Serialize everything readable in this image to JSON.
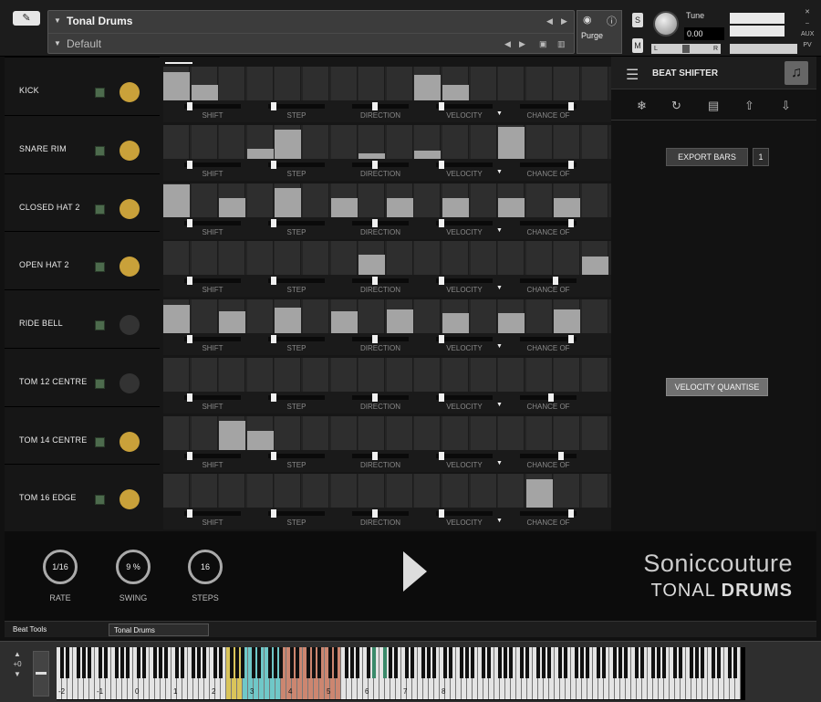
{
  "header": {
    "instrument_name": "Tonal Drums",
    "preset_name": "Default",
    "purge_label": "Purge",
    "tune_label": "Tune",
    "tune_value": "0.00",
    "solo_label": "S",
    "mute_label": "M",
    "pan_left": "L",
    "pan_right": "R",
    "aux_label": "AUX",
    "pv_label": "PV"
  },
  "controls_labels": {
    "shift": "SHIFT",
    "step": "STEP",
    "direction": "DIRECTION",
    "velocity": "VELOCITY",
    "chance": "CHANCE OF"
  },
  "tracks": [
    {
      "name": "KICK",
      "active": true,
      "bars": [
        0.85,
        0.45,
        0,
        0,
        0,
        0,
        0,
        0,
        0,
        0.75,
        0.45,
        0,
        0,
        0,
        0,
        0
      ]
    },
    {
      "name": "SNARE RIM",
      "active": true,
      "bars": [
        0,
        0,
        0,
        0.3,
        0.85,
        0,
        0,
        0.15,
        0,
        0.25,
        0,
        0,
        0.95,
        0,
        0,
        0
      ]
    },
    {
      "name": "CLOSED HAT 2",
      "active": true,
      "bars": [
        0.95,
        0,
        0.55,
        0,
        0.85,
        0,
        0.55,
        0,
        0.55,
        0,
        0.55,
        0,
        0.55,
        0,
        0.55,
        0
      ]
    },
    {
      "name": "OPEN HAT 2",
      "active": true,
      "bars": [
        0,
        0,
        0,
        0,
        0,
        0,
        0,
        0.6,
        0,
        0,
        0,
        0,
        0,
        0,
        0,
        0.55
      ]
    },
    {
      "name": "RIDE BELL",
      "active": false,
      "bars": [
        0.85,
        0,
        0.65,
        0,
        0.75,
        0,
        0.65,
        0,
        0.7,
        0,
        0.6,
        0,
        0.6,
        0,
        0.7,
        0
      ]
    },
    {
      "name": "TOM 12 CENTRE",
      "active": false,
      "bars": [
        0,
        0,
        0,
        0,
        0,
        0,
        0,
        0,
        0,
        0,
        0,
        0,
        0,
        0,
        0,
        0
      ]
    },
    {
      "name": "TOM 14 CENTRE",
      "active": true,
      "bars": [
        0,
        0,
        0.85,
        0.55,
        0,
        0,
        0,
        0,
        0,
        0,
        0,
        0,
        0,
        0,
        0,
        0
      ]
    },
    {
      "name": "TOM 16 EDGE",
      "active": true,
      "bars": [
        0,
        0,
        0,
        0,
        0,
        0,
        0,
        0,
        0,
        0,
        0,
        0,
        0,
        0.85,
        0,
        0
      ]
    }
  ],
  "colors": {
    "active_dot": "#c9a13a",
    "inactive_dot": "#333333",
    "mute_green": "#4d6b4d",
    "bar": "#a4a4a4"
  },
  "beat_shifter": {
    "title": "BEAT SHIFTER",
    "export_label": "EXPORT BARS",
    "export_value": "1",
    "velocity_quantise_label": "VELOCITY QUANTISE",
    "icons": [
      "snowflake-icon",
      "loop-icon",
      "chip-icon",
      "upload-icon",
      "download-icon"
    ]
  },
  "footer": {
    "rate_value": "1/16",
    "rate_label": "RATE",
    "swing_value": "9 %",
    "swing_label": "SWING",
    "steps_value": "16",
    "steps_label": "STEPS",
    "brand_line1": "Soniccouture",
    "brand_line2_a": "TONAL ",
    "brand_line2_b": "DRUMS"
  },
  "tabs": [
    "Beat Tools",
    "Tonal Drums"
  ],
  "keyboard": {
    "octave_shift": "+0",
    "octave_labels": [
      "-2",
      "-1",
      "0",
      "1",
      "2",
      "3",
      "4",
      "5",
      "6",
      "7",
      "8"
    ]
  }
}
